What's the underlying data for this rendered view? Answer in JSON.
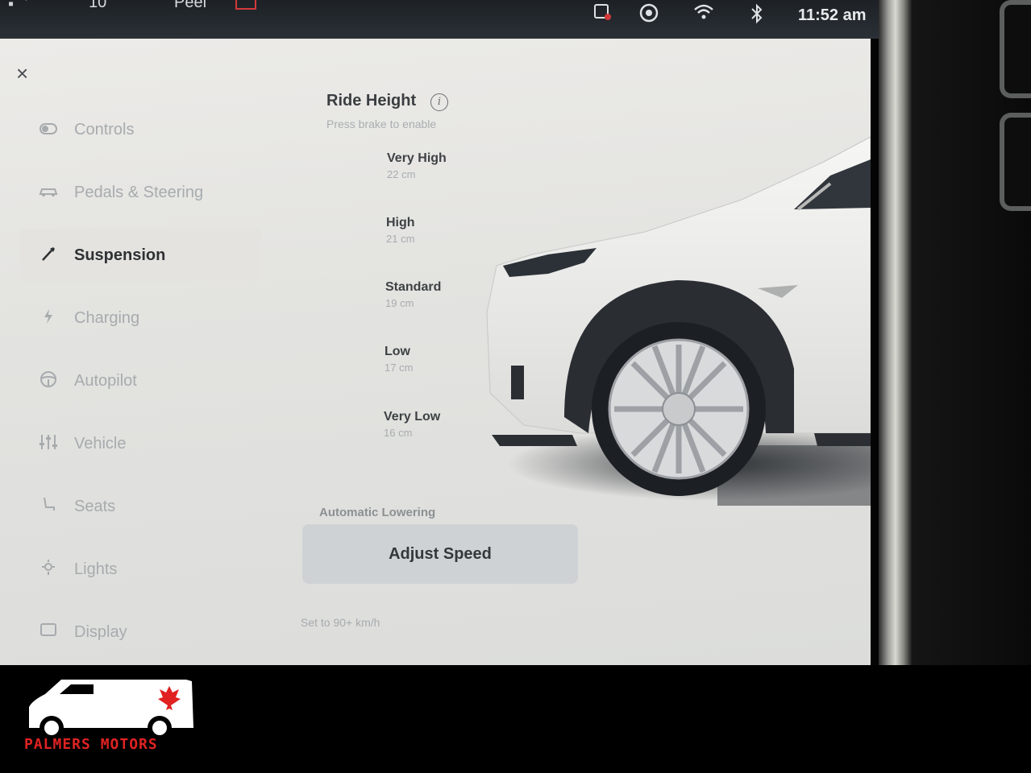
{
  "status_bar": {
    "partial_text_1": "10",
    "partial_text_2": "Peel",
    "clock": "11:52 am",
    "icons": [
      "phone-icon",
      "camera-icon",
      "wifi-icon",
      "bluetooth-icon"
    ]
  },
  "close_label": "×",
  "nav": {
    "items": [
      {
        "label": "Controls",
        "icon": "toggle-icon",
        "active": false
      },
      {
        "label": "Pedals & Steering",
        "icon": "car-icon",
        "active": false
      },
      {
        "label": "Suspension",
        "icon": "wrench-icon",
        "active": true
      },
      {
        "label": "Charging",
        "icon": "bolt-icon",
        "active": false
      },
      {
        "label": "Autopilot",
        "icon": "steering-wheel-icon",
        "active": false
      },
      {
        "label": "Vehicle",
        "icon": "sliders-icon",
        "active": false
      },
      {
        "label": "Seats",
        "icon": "seat-icon",
        "active": false
      },
      {
        "label": "Lights",
        "icon": "light-icon",
        "active": false
      },
      {
        "label": "Display",
        "icon": "display-icon",
        "active": false
      }
    ]
  },
  "ride_height": {
    "title": "Ride Height",
    "subtitle": "Press brake to enable",
    "levels": [
      {
        "name": "Very High",
        "value": "22 cm"
      },
      {
        "name": "High",
        "value": "21 cm"
      },
      {
        "name": "Standard",
        "value": "19 cm"
      },
      {
        "name": "Low",
        "value": "17 cm"
      },
      {
        "name": "Very Low",
        "value": "16 cm"
      }
    ]
  },
  "automatic_lowering": {
    "label": "Automatic Lowering",
    "button": "Adjust Speed",
    "note": "Set to 90+ km/h"
  },
  "logo": {
    "text": "PALMERS MOTORS",
    "colors": {
      "red": "#e02222",
      "white": "#ffffff"
    }
  }
}
